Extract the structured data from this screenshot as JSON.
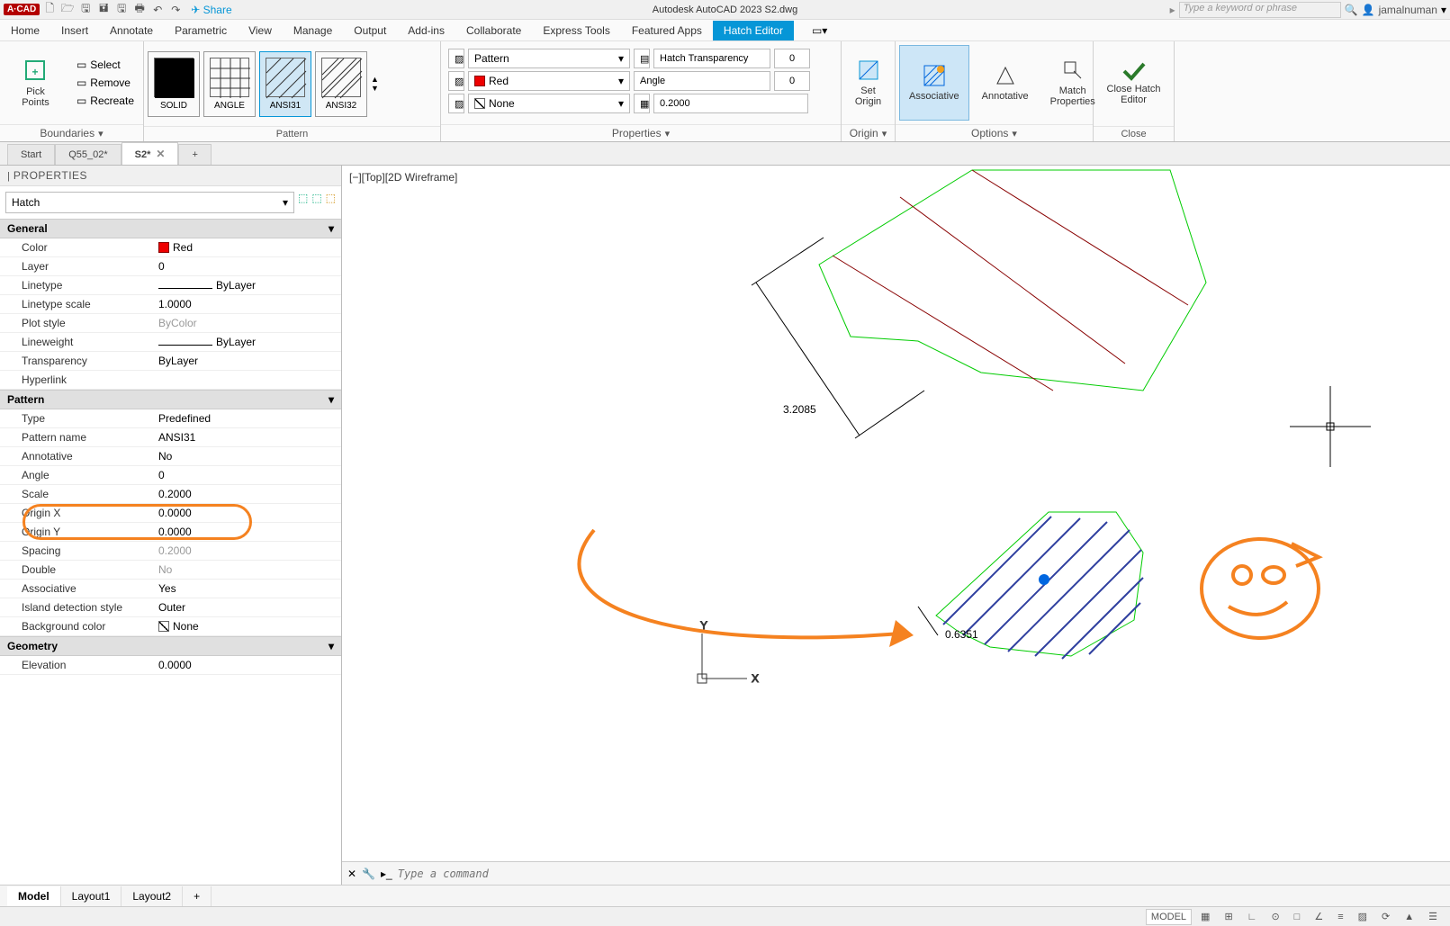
{
  "qat": {
    "share": "Share",
    "title": "Autodesk AutoCAD 2023   S2.dwg",
    "search_placeholder": "Type a keyword or phrase",
    "user": "jamalnuman"
  },
  "menubar": [
    "Home",
    "Insert",
    "Annotate",
    "Parametric",
    "View",
    "Manage",
    "Output",
    "Add-ins",
    "Collaborate",
    "Express Tools",
    "Featured Apps",
    "Hatch Editor"
  ],
  "menubar_active": "Hatch Editor",
  "ribbon": {
    "boundaries": {
      "pick": "Pick Points",
      "select": "Select",
      "remove": "Remove",
      "recreate": "Recreate",
      "title": "Boundaries"
    },
    "pattern": {
      "items": [
        "SOLID",
        "ANGLE",
        "ANSI31",
        "ANSI32"
      ],
      "selected": "ANSI31",
      "title": "Pattern"
    },
    "properties": {
      "pattern_label": "Pattern",
      "color": "Red",
      "none": "None",
      "transp_label": "Hatch Transparency",
      "transp_val": "0",
      "angle_label": "Angle",
      "angle_val": "0",
      "scale_val": "0.2000",
      "title": "Properties"
    },
    "origin": {
      "set": "Set Origin",
      "title": "Origin"
    },
    "options": {
      "assoc": "Associative",
      "annot": "Annotative",
      "match": "Match Properties",
      "title": "Options"
    },
    "close": {
      "btn": "Close Hatch Editor",
      "title": "Close"
    }
  },
  "doc_tabs": {
    "items": [
      "Start",
      "Q55_02*",
      "S2*"
    ],
    "active": "S2*"
  },
  "properties_panel": {
    "title": "PROPERTIES",
    "selector": "Hatch",
    "groups": [
      {
        "name": "General",
        "rows": [
          {
            "k": "Color",
            "v": "Red",
            "swatch": "red"
          },
          {
            "k": "Layer",
            "v": "0"
          },
          {
            "k": "Linetype",
            "v": "ByLayer",
            "line": true
          },
          {
            "k": "Linetype scale",
            "v": "1.0000"
          },
          {
            "k": "Plot style",
            "v": "ByColor",
            "gray": true
          },
          {
            "k": "Lineweight",
            "v": "ByLayer",
            "line": true
          },
          {
            "k": "Transparency",
            "v": "ByLayer"
          },
          {
            "k": "Hyperlink",
            "v": ""
          }
        ]
      },
      {
        "name": "Pattern",
        "rows": [
          {
            "k": "Type",
            "v": "Predefined"
          },
          {
            "k": "Pattern name",
            "v": "ANSI31"
          },
          {
            "k": "Annotative",
            "v": "No"
          },
          {
            "k": "Angle",
            "v": "0"
          },
          {
            "k": "Scale",
            "v": "0.2000",
            "hl": true
          },
          {
            "k": "Origin X",
            "v": "0.0000"
          },
          {
            "k": "Origin Y",
            "v": "0.0000"
          },
          {
            "k": "Spacing",
            "v": "0.2000",
            "gray": true
          },
          {
            "k": "Double",
            "v": "No",
            "gray": true
          },
          {
            "k": "Associative",
            "v": "Yes"
          },
          {
            "k": "Island detection style",
            "v": "Outer"
          },
          {
            "k": "Background color",
            "v": "None",
            "swatch": "none"
          }
        ]
      },
      {
        "name": "Geometry",
        "rows": [
          {
            "k": "Elevation",
            "v": "0.0000"
          }
        ]
      }
    ]
  },
  "canvas": {
    "viewlabel": "[−][Top][2D Wireframe]",
    "dim1": "3.2085",
    "dim2": "0.6351",
    "cmd_placeholder": "Type a command"
  },
  "layout_tabs": {
    "items": [
      "Model",
      "Layout1",
      "Layout2"
    ],
    "active": "Model"
  },
  "statusbar": {
    "model": "MODEL"
  }
}
